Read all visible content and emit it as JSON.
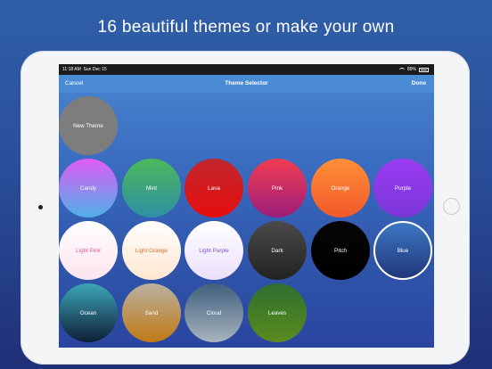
{
  "headline": "16 beautiful themes or make your own",
  "status": {
    "time": "11:18 AM",
    "date": "Sun Dec 15",
    "battery": "89%"
  },
  "nav": {
    "cancel": "Cancel",
    "title": "Theme Selector",
    "done": "Done"
  },
  "new_theme": "New Theme",
  "selected_theme": "Blue",
  "themes": [
    {
      "label": "Candy",
      "colors": [
        "#e05cf5",
        "#4fb0e8"
      ],
      "text_color": "#ffffff"
    },
    {
      "label": "Mint",
      "colors": [
        "#4cb85a",
        "#2f8fa5"
      ],
      "text_color": "#ffffff"
    },
    {
      "label": "Lava",
      "colors": [
        "#c0272d",
        "#e60d0d"
      ],
      "text_color": "#ffffff"
    },
    {
      "label": "Pink",
      "colors": [
        "#f23c52",
        "#9c1d7a"
      ],
      "text_color": "#ffffff"
    },
    {
      "label": "Orange",
      "colors": [
        "#ff8f37",
        "#f2592a"
      ],
      "text_color": "#ffffff"
    },
    {
      "label": "Purple",
      "colors": [
        "#9b3cf2",
        "#7a36d8"
      ],
      "text_color": "#ffffff"
    },
    {
      "label": "Light Pink",
      "colors": [
        "#ffffff",
        "#fde4ef"
      ],
      "text_color": "#e8508a"
    },
    {
      "label": "Light Orange",
      "colors": [
        "#ffffff",
        "#ffe7cf"
      ],
      "text_color": "#e06a2c"
    },
    {
      "label": "Light Purple",
      "colors": [
        "#ffffff",
        "#ebe0fb"
      ],
      "text_color": "#7a4fd0"
    },
    {
      "label": "Dark",
      "colors": [
        "#4a4a4a",
        "#222222"
      ],
      "text_color": "#ffffff"
    },
    {
      "label": "Pitch",
      "colors": [
        "#050505",
        "#000000"
      ],
      "text_color": "#ffffff"
    },
    {
      "label": "Blue",
      "colors": [
        "#3f79c6",
        "#1e3577"
      ],
      "text_color": "#ffffff"
    },
    {
      "label": "Ocean",
      "colors": [
        "#3ea5b8",
        "#0d1f36"
      ],
      "text_color": "#ffffff"
    },
    {
      "label": "Sand",
      "colors": [
        "#b9b0a0",
        "#c07a14"
      ],
      "text_color": "#ffffff"
    },
    {
      "label": "Cloud",
      "colors": [
        "#3e5f7d",
        "#a9b3bd"
      ],
      "text_color": "#ffffff"
    },
    {
      "label": "Leaves",
      "colors": [
        "#2f6f2f",
        "#5a8b1f"
      ],
      "text_color": "#ffffff"
    }
  ]
}
